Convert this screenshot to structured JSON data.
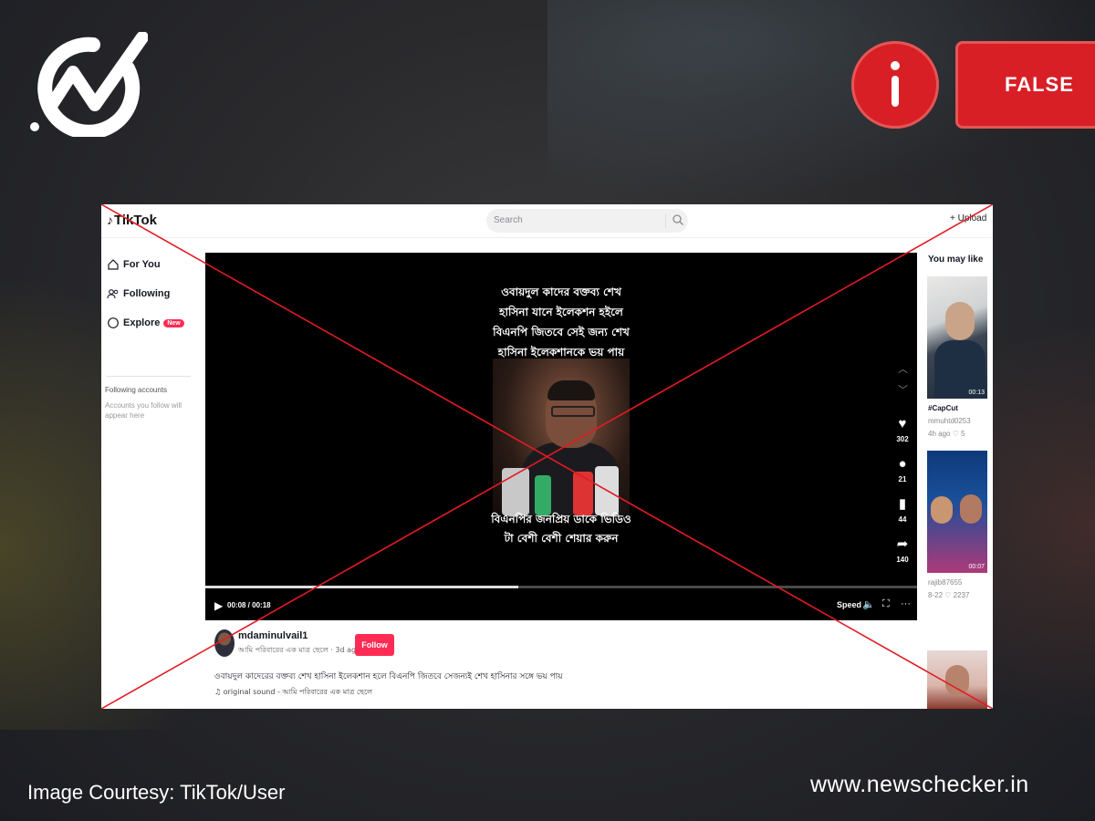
{
  "colors": {
    "verdict_red": "#d81f26",
    "tiktok_pink": "#fe2c55",
    "cross_line": "#e21b23"
  },
  "brand": {
    "logo_icon": "newschecker-check-logo-icon"
  },
  "verdict": {
    "info_icon": "info-icon",
    "label": "FALSE"
  },
  "tiktok": {
    "logo": "TikTok",
    "search_placeholder": "Search",
    "upload": "+ Upload",
    "nav": [
      {
        "icon": "home-icon",
        "label": "For You"
      },
      {
        "icon": "people-icon",
        "label": "Following"
      },
      {
        "icon": "compass-icon",
        "label": "Explore",
        "badge": "New"
      }
    ],
    "following_accounts_title": "Following accounts",
    "following_accounts_note": "Accounts you follow will appear here",
    "video": {
      "caption_top": [
        "ওবায়দুল কাদের বক্তব্য শেখ",
        "হাসিনা যানে ইলেকশন হইলে",
        "বিএনপি জিতবে সেই জন্য শেখ",
        "হাসিনা ইলেকশানকে ভয় পায়"
      ],
      "caption_bottom": [
        "বিএনপির জনপ্রিয় ডাকে ভিডিও",
        "টা বেশী বেশী শেয়ার করুন"
      ],
      "time": "00:08 / 00:18",
      "progress": 0.44,
      "speed": "Speed",
      "likes": "302",
      "comments": "21",
      "saves": "44",
      "shares": "140"
    },
    "author": {
      "username": "mdaminulvail1",
      "subtitle": "আমি পরিবারের এক মাত্র ছেলে · 3d ago",
      "follow": "Follow",
      "description": "ওবায়দুল কাদেরের বক্তব্য শেখ হাসিনা ইলেকশান হলে বিএনপি জিতবে সেজন্যই শেখ হাসিনার সঙ্গে ভয় পায়",
      "sound": "♫ original sound - আমি পরিবারের এক মাত্র ছেলে"
    },
    "right": {
      "title": "You may like",
      "items": [
        {
          "duration": "00:13",
          "title": "#CapCut",
          "user": "mmuhtd0253",
          "meta": "4h ago ♡ 5"
        },
        {
          "duration": "00:07",
          "user": "rajib87655",
          "meta": "8-22 ♡ 2237"
        }
      ]
    }
  },
  "footer": {
    "credit": "Image Courtesy: TikTok/User",
    "site": "www.newschecker.in"
  }
}
